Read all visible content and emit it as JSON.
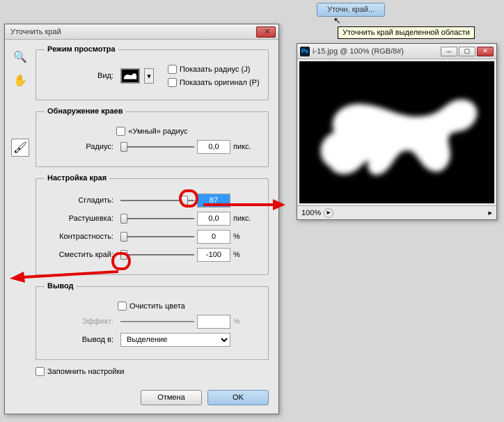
{
  "top_button": "Уточн. край...",
  "tooltip": "Уточнить край выделенной области",
  "dialog": {
    "title": "Уточнить край",
    "view_mode": {
      "legend": "Режим просмотра",
      "label": "Вид:",
      "show_radius": "Показать радиус (J)",
      "show_original": "Показать оригинал (P)"
    },
    "edge_detect": {
      "legend": "Обнаружение краев",
      "smart_radius": "«Умный» радиус",
      "radius_label": "Радиус:",
      "radius_value": "0,0",
      "unit": "пикс."
    },
    "adjust": {
      "legend": "Настройка края",
      "smooth_label": "Сгладить:",
      "smooth_value": "87",
      "feather_label": "Растушевка:",
      "feather_value": "0,0",
      "feather_unit": "пикс.",
      "contrast_label": "Контрастность:",
      "contrast_value": "0",
      "contrast_unit": "%",
      "shift_label": "Сместить край:",
      "shift_value": "-100",
      "shift_unit": "%"
    },
    "output": {
      "legend": "Вывод",
      "decontaminate": "Очистить цвета",
      "amount_label": "Эффект:",
      "amount_value": "",
      "amount_unit": "%",
      "output_to": "Вывод в:",
      "output_value": "Выделение"
    },
    "remember": "Запомнить настройки",
    "cancel": "Отмена",
    "ok": "OK"
  },
  "image_window": {
    "title": "i-15.jpg @ 100% (RGB/8#)",
    "zoom": "100%"
  }
}
